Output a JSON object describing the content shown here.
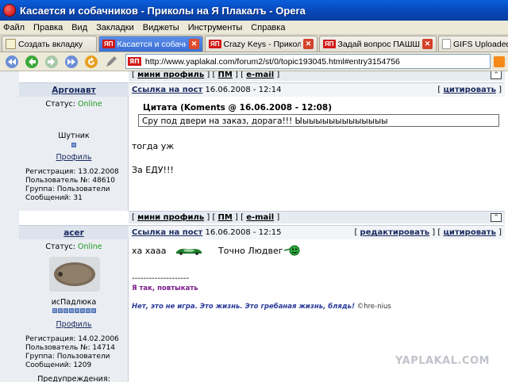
{
  "window": {
    "title": "Касается и собачников - Приколы на Я Плакалъ - Opera"
  },
  "menu": [
    "Файл",
    "Правка",
    "Вид",
    "Закладки",
    "Виджеты",
    "Инструменты",
    "Справка"
  ],
  "tabs": [
    {
      "icon": "new-tab-icon",
      "label": "Создать вкладку"
    },
    {
      "icon": "yap-favicon",
      "fav": "ЯП",
      "label": "Касается и собачников...",
      "active": true
    },
    {
      "icon": "yap-favicon",
      "fav": "ЯП",
      "label": "Crazy Keys - Приколы н..."
    },
    {
      "icon": "yap-favicon",
      "fav": "ЯП",
      "label": "Задай вопрос ПАШШО ..."
    },
    {
      "icon": "page-icon",
      "label": "GIFS Uploaded! :: S"
    }
  ],
  "address": {
    "favicon": "ЯП",
    "url": "http://www.yaplakal.com/forum2/st/0/topic193045.html#entry3154756"
  },
  "footer_links": {
    "mini_profile": "мини профиль",
    "pm": "ПМ",
    "email": "e-mail",
    "up": "^"
  },
  "posts": [
    {
      "user": "Аргонавт",
      "status_label": "Статус:",
      "status": "Online",
      "rank": "Шутник",
      "profile": "Профиль",
      "reg": "Регистрация: 13.02.2008",
      "num": "Пользователь №: 48610",
      "group": "Группа: Пользователи",
      "messages": "Сообщений: 31",
      "post_link": "Ссылка на пост",
      "date": "16.06.2008 - 12:14",
      "quote_action": "цитировать",
      "quote_title": "Цитата (Koments @ 16.06.2008 - 12:08)",
      "quote_text": "Сру под двери на заказ, дорага!!! Ыыыыыыыыыыыыыы",
      "text1": "тогда уж",
      "text2": "За ЕДУ!!!"
    },
    {
      "user": "acer",
      "status_label": "Статус:",
      "status": "Online",
      "rank": "исПадлюка",
      "profile": "Профиль",
      "reg": "Регистрация: 14.02.2006",
      "num": "Пользователь №: 14714",
      "group": "Группа: Пользователи",
      "messages": "Сообщений: 1209",
      "warnings": "Предупреждения:",
      "post_link": "Ссылка на пост",
      "date": "16.06.2008 - 12:15",
      "edit_action": "редактировать",
      "quote_action": "цитировать",
      "text_a": "ха хааа",
      "text_b": "Точно Людвег",
      "sig_line": "--------------------",
      "sig1": "Я так, повтыкать",
      "sig2": "Нет, это не игра. Это жизнь. Это гребаная жизнь, блядь!",
      "sig2_author": "©hre-nius"
    }
  ],
  "watermark": "YAPLAKAL.COM",
  "colors": {
    "title_bar": "#0747b8",
    "online": "#1e9a1e",
    "link": "#1a2a60",
    "sig_purple": "#7a1a8a",
    "sig_blue": "#2a3a9a"
  }
}
